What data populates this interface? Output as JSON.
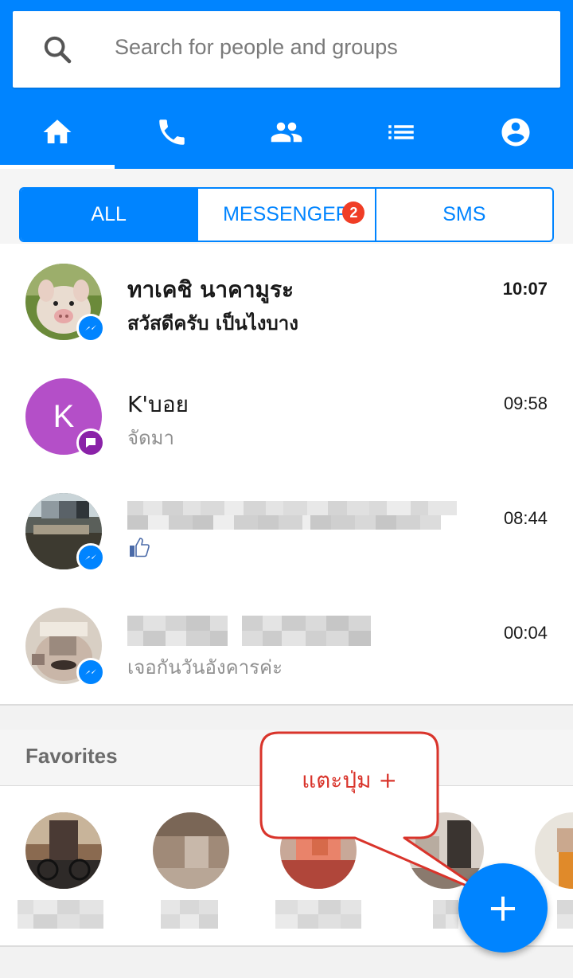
{
  "search": {
    "placeholder": "Search for people and groups",
    "icon": "search-icon"
  },
  "nav_tabs": [
    {
      "icon": "home-icon",
      "active": true
    },
    {
      "icon": "phone-icon",
      "active": false
    },
    {
      "icon": "people-icon",
      "active": false
    },
    {
      "icon": "list-icon",
      "active": false
    },
    {
      "icon": "profile-icon",
      "active": false
    }
  ],
  "filter": {
    "all": "ALL",
    "messenger": "MESSENGER",
    "messenger_badge": "2",
    "sms": "SMS",
    "selected": "ALL"
  },
  "conversations": [
    {
      "name": "ทาเคชิ นาคามูระ",
      "preview": "สวัสดีครับ เป็นไงบาง",
      "time": "10:07",
      "unread": true,
      "source": "messenger",
      "avatar": "pig-photo"
    },
    {
      "name": "K'บอย",
      "preview": "จัดมา",
      "time": "09:58",
      "unread": false,
      "source": "sms",
      "avatar_letter": "K",
      "avatar_color": "#b44fc8"
    },
    {
      "name": "",
      "preview_icon": "thumbs-up-icon",
      "time": "08:44",
      "unread": false,
      "source": "messenger",
      "name_redacted": true
    },
    {
      "name": "",
      "preview": "เจอกันวันอังคารค่ะ",
      "time": "00:04",
      "unread": false,
      "source": "messenger",
      "name_redacted": true
    }
  ],
  "favorites": {
    "title": "Favorites",
    "count_visible": 5
  },
  "callout": {
    "text": "แตะปุ่ม +"
  },
  "fab": {
    "label": "+",
    "icon": "plus-icon"
  },
  "colors": {
    "brand": "#0084ff",
    "badge": "#f03d25",
    "callout_text": "#d9342b",
    "sms_avatar": "#b44fc8"
  }
}
